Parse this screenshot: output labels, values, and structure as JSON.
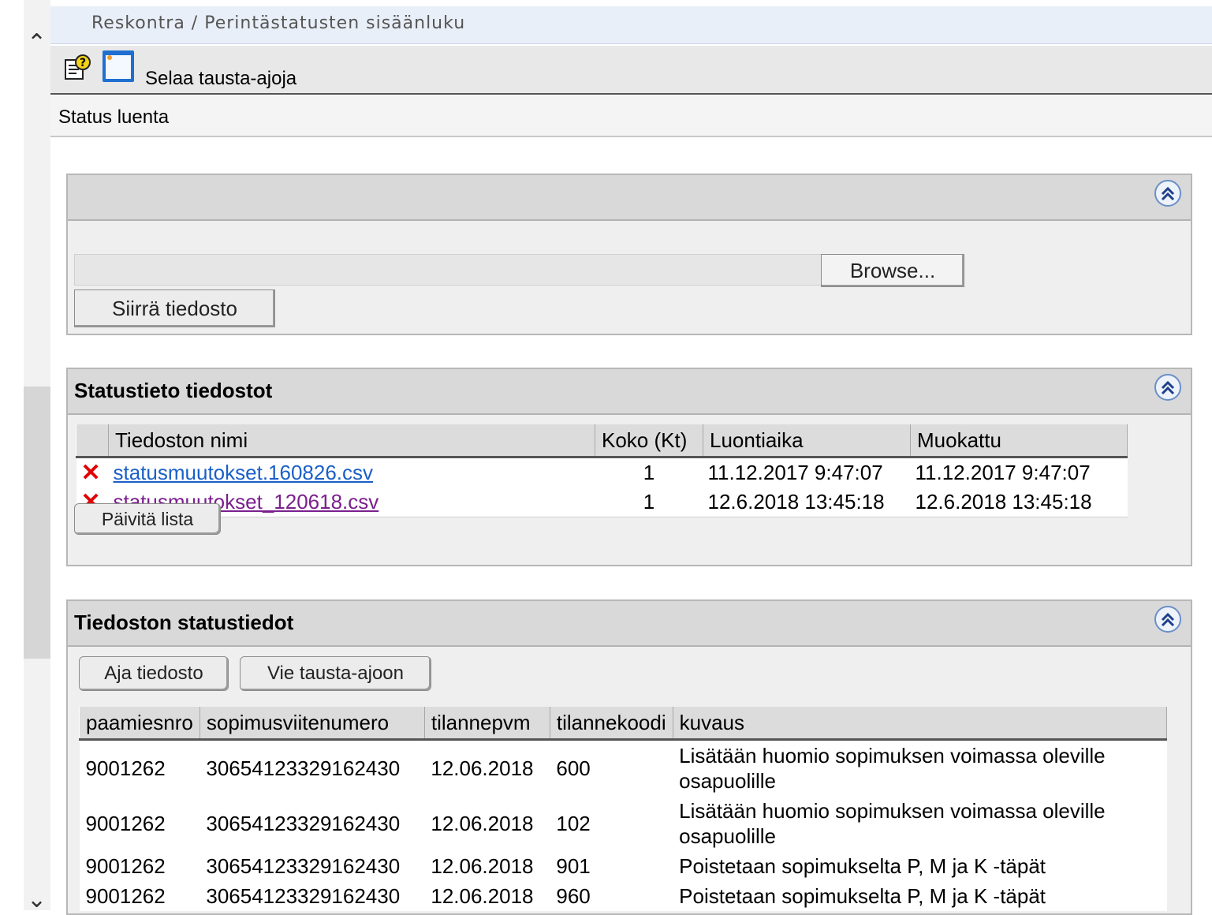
{
  "breadcrumb": {
    "text": "Reskontra / Perintästatusten sisäänluku"
  },
  "toolbar": {
    "help_icon": "help-icon",
    "window_icon": "window-icon",
    "label": "Selaa tausta-ajoja"
  },
  "subheader": {
    "title": "Status luenta"
  },
  "upload_panel": {
    "file_value": "",
    "browse_label": "Browse...",
    "submit_label": "Siirrä tiedosto"
  },
  "files_panel": {
    "title": "Statustieto tiedostot",
    "columns": [
      "",
      "Tiedoston nimi",
      "Koko (Kt)",
      "Luontiaika",
      "Muokattu"
    ],
    "rows": [
      {
        "name": "statusmuutokset.160826.csv",
        "size": "1",
        "created": "11.12.2017 9:47:07",
        "modified": "11.12.2017 9:47:07"
      },
      {
        "name": "statusmuutokset_120618.csv",
        "size": "1",
        "created": "12.6.2018 13:45:18",
        "modified": "12.6.2018 13:45:18"
      }
    ],
    "refresh_label": "Päivitä lista"
  },
  "status_panel": {
    "title": "Tiedoston statustiedot",
    "run_label": "Aja tiedosto",
    "background_label": "Vie tausta-ajoon",
    "columns": [
      "paamiesnro",
      "sopimusviitenumero",
      "tilannepvm",
      "tilannekoodi",
      "kuvaus"
    ],
    "rows": [
      {
        "paamiesnro": "9001262",
        "ref": "30654123329162430",
        "date": "12.06.2018",
        "code": "600",
        "desc": "Lisätään huomio sopimuksen voimassa oleville osapuolille"
      },
      {
        "paamiesnro": "9001262",
        "ref": "30654123329162430",
        "date": "12.06.2018",
        "code": "102",
        "desc": "Lisätään huomio sopimuksen voimassa oleville osapuolille"
      },
      {
        "paamiesnro": "9001262",
        "ref": "30654123329162430",
        "date": "12.06.2018",
        "code": "901",
        "desc": "Poistetaan sopimukselta P, M ja K -täpät"
      },
      {
        "paamiesnro": "9001262",
        "ref": "30654123329162430",
        "date": "12.06.2018",
        "code": "960",
        "desc": "Poistetaan sopimukselta P, M ja K -täpät"
      }
    ]
  },
  "colors": {
    "accent": "#1a5fc8",
    "visited_link": "#7b1f8e",
    "delete": "#e00000"
  }
}
